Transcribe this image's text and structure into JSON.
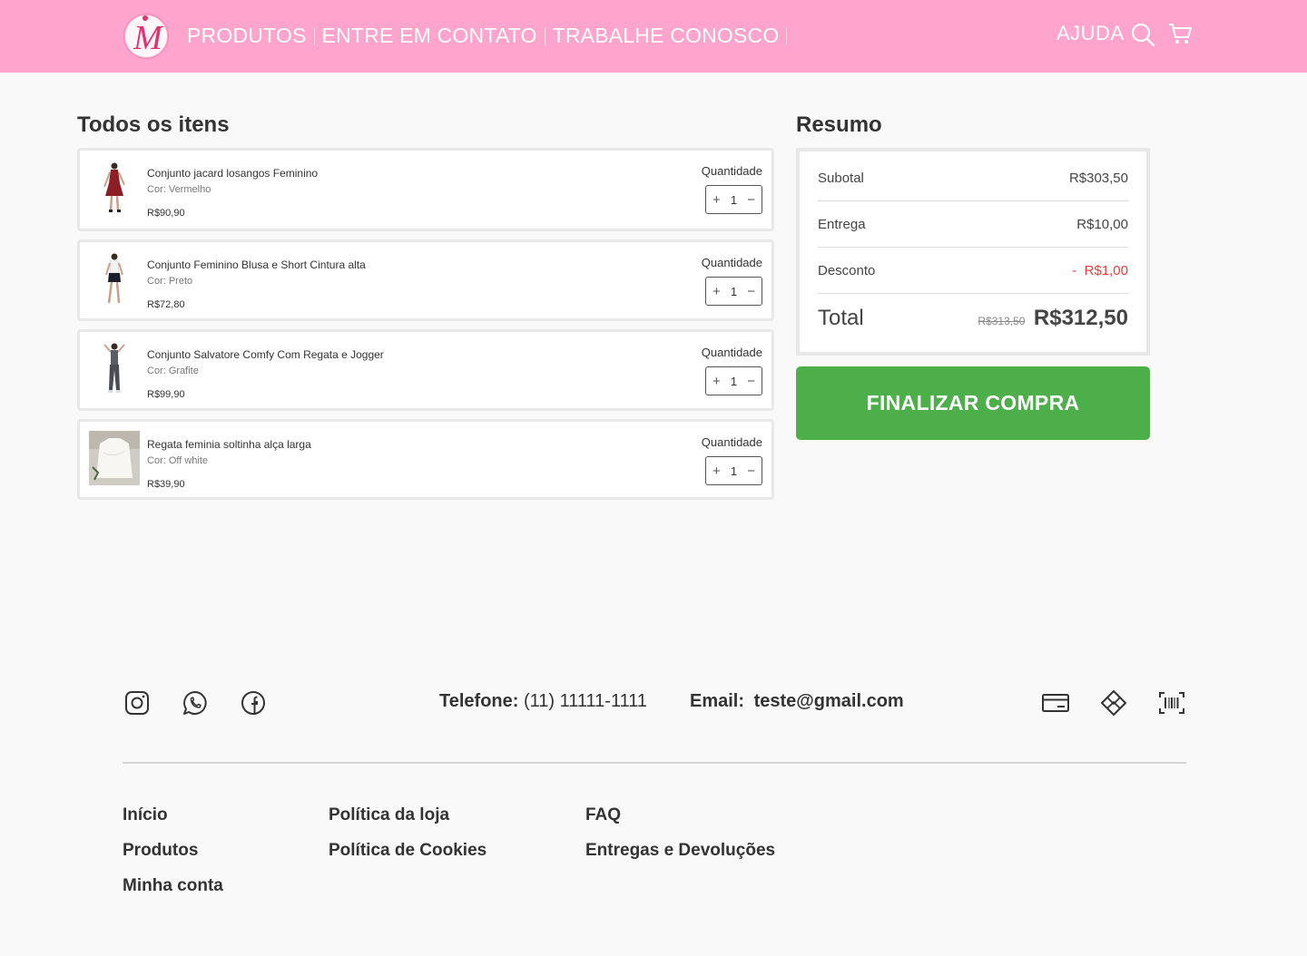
{
  "header": {
    "logo_letter": "M",
    "nav": [
      "PRODUTOS",
      "ENTRE  EM CONTATO",
      "TRABALHE CONOSCO"
    ],
    "help": "AJUDA",
    "icons": [
      "search-icon",
      "cart-icon"
    ]
  },
  "cart": {
    "title": "Todos os itens",
    "items": [
      {
        "name": "Conjunto jacard losangos Feminino",
        "color": "Cor: Vermelho",
        "price": "R$90,90",
        "qty_label": "Quantidade",
        "qty": "1"
      },
      {
        "name": "Conjunto Feminino Blusa e Short Cintura alta",
        "color": "Cor: Preto",
        "price": "R$72,80",
        "qty_label": "Quantidade",
        "qty": "1"
      },
      {
        "name": "Conjunto Salvatore Comfy Com Regata e Jogger",
        "color": "Cor: Grafite",
        "price": "R$99,90",
        "qty_label": "Quantidade",
        "qty": "1"
      },
      {
        "name": "Regata feminia soltinha alça larga",
        "color": "Cor: Off white",
        "price": "R$39,90",
        "qty_label": "Quantidade",
        "qty": "1"
      }
    ]
  },
  "summary": {
    "title": "Resumo",
    "subtotal_label": "Subotal",
    "subtotal": "R$303,50",
    "delivery_label": "Entrega",
    "delivery": "R$10,00",
    "discount_label": "Desconto",
    "discount": "-  R$1,00",
    "total_label": "Total",
    "total_old": "R$313,50",
    "total": "R$312,50",
    "checkout": "FINALIZAR COMPRA",
    "colors": {
      "checkout": "#4caf4a",
      "discount": "#e23d3d",
      "header": "#ffa4cc"
    }
  },
  "footer": {
    "social_icons": [
      "instagram-icon",
      "whatsapp-icon",
      "facebook-icon"
    ],
    "phone_label": "Telefone:",
    "phone": "(11) 11111-1111",
    "email_label": "Email:",
    "email": "teste@gmail.com",
    "payment_icons": [
      "credit-card-icon",
      "pix-icon",
      "barcode-icon"
    ],
    "links": {
      "col1": [
        "Início",
        "Produtos",
        "Minha conta"
      ],
      "col2": [
        "Política da loja",
        "Política de Cookies"
      ],
      "col3": [
        "FAQ",
        "Entregas e Devoluções"
      ]
    }
  }
}
